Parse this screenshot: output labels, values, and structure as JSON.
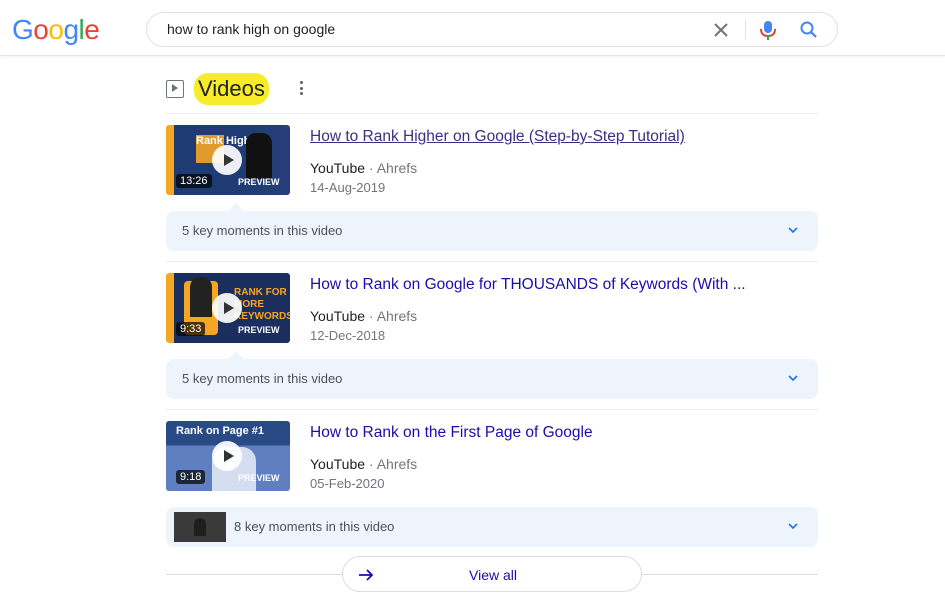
{
  "header": {
    "logo_letters": [
      {
        "ch": "G",
        "color": "#4285F4"
      },
      {
        "ch": "o",
        "color": "#EA4335"
      },
      {
        "ch": "o",
        "color": "#FBBC05"
      },
      {
        "ch": "g",
        "color": "#4285F4"
      },
      {
        "ch": "l",
        "color": "#34A853"
      },
      {
        "ch": "e",
        "color": "#EA4335"
      }
    ],
    "search_query": "how to rank high on google",
    "icons": {
      "clear": "close-icon",
      "mic": "microphone-icon",
      "search": "search-icon"
    }
  },
  "section": {
    "title": "Videos",
    "highlight_color": "#f6ec2a",
    "icons": {
      "leading": "play-box-icon",
      "menu": "more-vert-icon"
    }
  },
  "videos": [
    {
      "title": "How to Rank Higher on Google (Step-by-Step Tutorial)",
      "visited": true,
      "source": "YouTube",
      "channel": "Ahrefs",
      "date": "14-Aug-2019",
      "duration": "13:26",
      "thumb_text": "Rank Higher",
      "thumb_overlay": "PREVIEW",
      "thumb_color": "#1f3b73",
      "moments": "5 key moments in this video"
    },
    {
      "title": "How to Rank on Google for THOUSANDS of Keywords (With ...",
      "visited": false,
      "source": "YouTube",
      "channel": "Ahrefs",
      "date": "12-Dec-2018",
      "duration": "9:33",
      "thumb_text": "RANK FOR MORE KEYWORDS",
      "thumb_overlay": "PREVIEW",
      "thumb_color": "#1a2f5e",
      "moments": "5 key moments in this video"
    },
    {
      "title": "How to Rank on the First Page of Google",
      "visited": false,
      "source": "YouTube",
      "channel": "Ahrefs",
      "date": "05-Feb-2020",
      "duration": "9:18",
      "thumb_text": "Rank on Page #1",
      "thumb_overlay": "PREVIEW",
      "thumb_color": "#2a4a86",
      "moments": "8 key moments in this video"
    }
  ],
  "separator": "·",
  "view_all": {
    "label": "View all",
    "icon": "arrow-forward-icon"
  },
  "colors": {
    "link": "#1a0dab",
    "visited_link": "#3c2e85",
    "moments_bg": "#eef4fc",
    "orange_strip": "#f5a623"
  }
}
